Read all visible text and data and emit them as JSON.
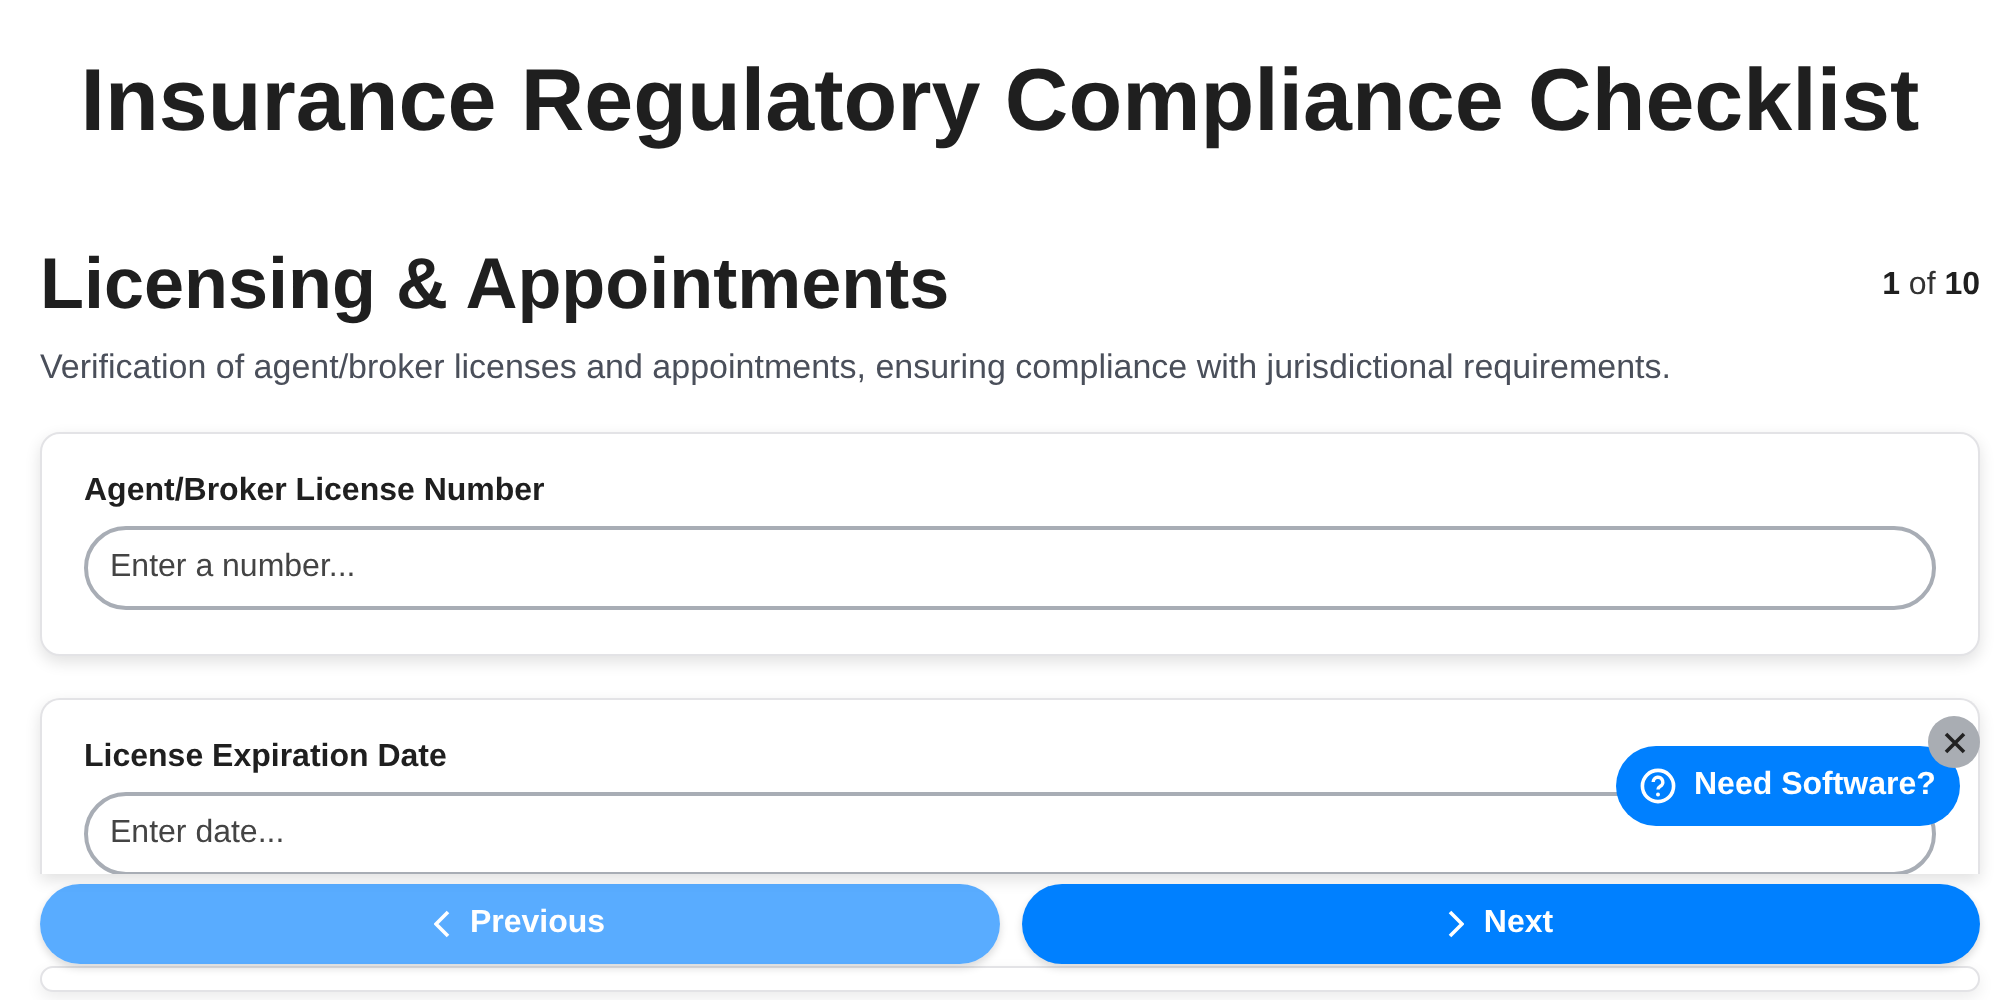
{
  "title": "Insurance Regulatory Compliance Checklist",
  "section": {
    "heading": "Licensing & Appointments",
    "progress": "**1** of **10**",
    "description": "Verification of agent/broker licenses and appointments, ensuring compliance with jurisdictional requirements."
  },
  "fields": [
    {
      "label": "Agent/Broker License Number",
      "placeholder": "Enter a number..."
    },
    {
      "label": "License Expiration Date",
      "placeholder": "Enter date..."
    }
  ],
  "next_card": {
    "kind": "card"
  },
  "navigation": [
    {
      "label": "Previous",
      "kind": "previous",
      "disabled": true
    },
    {
      "label": "Next",
      "kind": "next",
      "disabled": false
    }
  ],
  "help_bubble": {
    "label": "Need Software?",
    "closable": true
  }
}
